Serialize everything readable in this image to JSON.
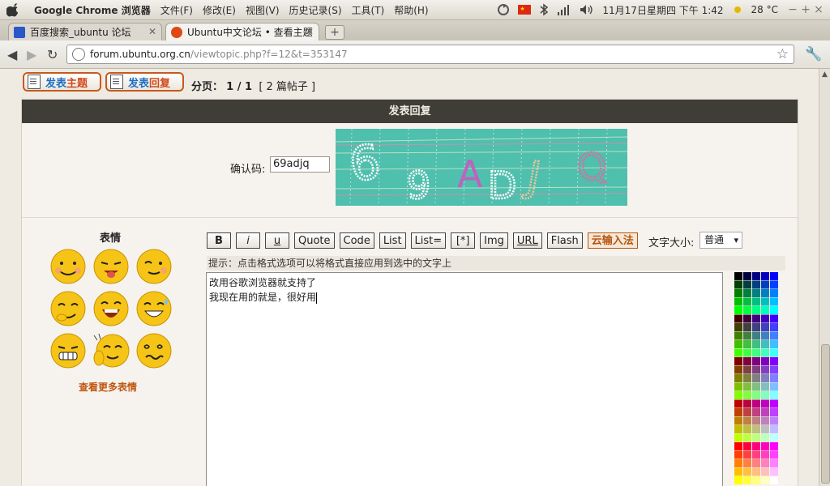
{
  "system_bar": {
    "app_name": "Google Chrome 浏览器",
    "menus": [
      "文件(F)",
      "修改(E)",
      "视图(V)",
      "历史记录(S)",
      "工具(T)",
      "帮助(H)"
    ],
    "datetime": "11月17日星期四 下午 1:42",
    "weather": "28 °C"
  },
  "tabs": [
    {
      "title": "百度搜索_ubuntu 论坛"
    },
    {
      "title": "Ubuntu中文论坛 • 查看主题"
    }
  ],
  "address": {
    "host": "forum.ubuntu.org.cn",
    "path": "/viewtopic.php?f=12&t=353147"
  },
  "page": {
    "post_topic": {
      "a": "发表",
      "b": "主题"
    },
    "post_reply": {
      "a": "发表",
      "b": "回复"
    },
    "pagination_label": "分页：",
    "pagination_value": "1 / 1",
    "post_count": "[ 2 篇帖子 ]",
    "panel_title": "发表回复",
    "captcha_label": "确认码:",
    "captcha_value": "69adjq",
    "smileys_title": "表情",
    "more_smileys": "查看更多表情",
    "format_buttons": [
      "B",
      "i",
      "u",
      "Quote",
      "Code",
      "List",
      "List=",
      "[*]",
      "Img",
      "URL",
      "Flash"
    ],
    "ime_button": "云输入法",
    "font_size_label": "文字大小:",
    "font_size_value": "普通",
    "hint": "提示：点击格式选项可以将格式直接应用到选中的文字上",
    "editor_lines": [
      "改用谷歌浏览器就支持了",
      "我现在用的就是，很好用"
    ]
  },
  "colors": {
    "panel_header": "#3e3d36",
    "button_border": "#c65a1e",
    "link_blue": "#1e6fc2",
    "accent_orange": "#c0560f",
    "captcha_bg": "#4fbfae"
  }
}
